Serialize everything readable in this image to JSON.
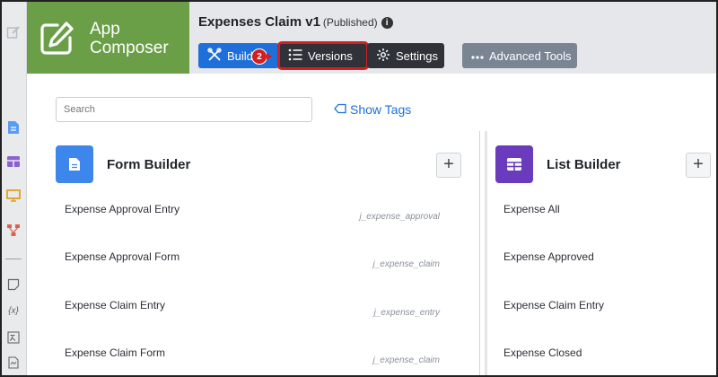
{
  "app": {
    "logo_line1": "App",
    "logo_line2": "Composer"
  },
  "header": {
    "title": "Expenses Claim v1",
    "status": "(Published)",
    "info_glyph": "i",
    "buttons": {
      "build": "Build",
      "versions": "Versions",
      "settings": "Settings",
      "advanced": "Advanced Tools"
    },
    "annotation_badge": "2"
  },
  "toolbar": {
    "search_placeholder": "Search",
    "show_tags": "Show Tags"
  },
  "form_builder": {
    "title": "Form Builder",
    "add": "+",
    "items": [
      {
        "name": "Expense Approval Entry",
        "code": "j_expense_approval"
      },
      {
        "name": "Expense Approval Form",
        "code": "j_expense_claim"
      },
      {
        "name": "Expense Claim Entry",
        "code": "j_expense_entry"
      },
      {
        "name": "Expense Claim Form",
        "code": "j_expense_claim"
      }
    ]
  },
  "list_builder": {
    "title": "List Builder",
    "add": "+",
    "items": [
      "Expense All",
      "Expense Approved",
      "Expense Claim Entry",
      "Expense Closed"
    ]
  },
  "colors": {
    "logo_bg": "#6a9f47",
    "build_button": "#1e6fd9",
    "dark_button": "#2f3339",
    "advanced_button": "#7a8594",
    "highlight": "#d21f1f",
    "form_icon_bg": "#3d86ec",
    "list_icon_bg": "#6a3bbd"
  },
  "icons": {
    "rail": [
      "edit-icon",
      "document-icon",
      "table-icon",
      "monitor-icon",
      "flow-icon",
      "note-icon",
      "variable-icon",
      "translate-icon",
      "file-icon"
    ],
    "logo": "edit-square-icon",
    "build": "tools-icon",
    "versions": "list-icon",
    "settings": "gear-icon",
    "advanced": "dots-icon",
    "tags": "tag-icon",
    "form": "document-icon",
    "list": "table-icon"
  }
}
